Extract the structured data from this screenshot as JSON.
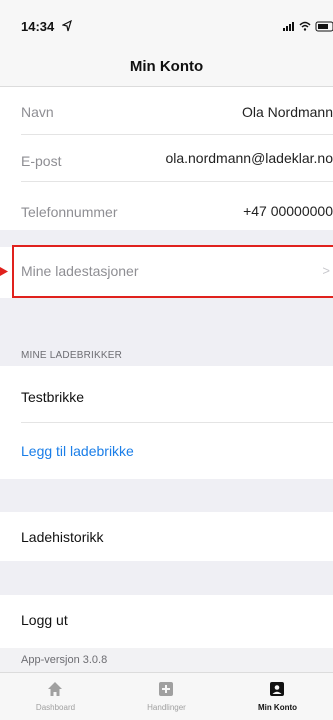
{
  "status_bar": {
    "time": "14:34"
  },
  "nav": {
    "title": "Min Konto"
  },
  "profile": {
    "name_label": "Navn",
    "name_value": "Ola Nordmann",
    "email_label": "E-post",
    "email_value": "ola.nordmann@ladeklar.no",
    "phone_label": "Telefonnummer",
    "phone_value": "+47 00000000"
  },
  "stations": {
    "label": "Mine ladestasjoner",
    "chevron": ">"
  },
  "chips": {
    "header": "MINE LADEBRIKKER",
    "items": [
      {
        "label": "Testbrikke"
      }
    ],
    "add_label": "Legg til ladebrikke"
  },
  "history": {
    "label": "Ladehistorikk"
  },
  "logout": {
    "label": "Logg ut"
  },
  "version": {
    "text": "App-versjon 3.0.8"
  },
  "tabs": [
    {
      "label": "Dashboard",
      "icon": "home-icon",
      "active": false
    },
    {
      "label": "Handlinger",
      "icon": "plus-square-icon",
      "active": false
    },
    {
      "label": "Min Konto",
      "icon": "account-card-icon",
      "active": true
    }
  ],
  "colors": {
    "accent_link": "#1a7ee8",
    "highlight_border": "#e0211d",
    "group_background": "#efeff4"
  }
}
